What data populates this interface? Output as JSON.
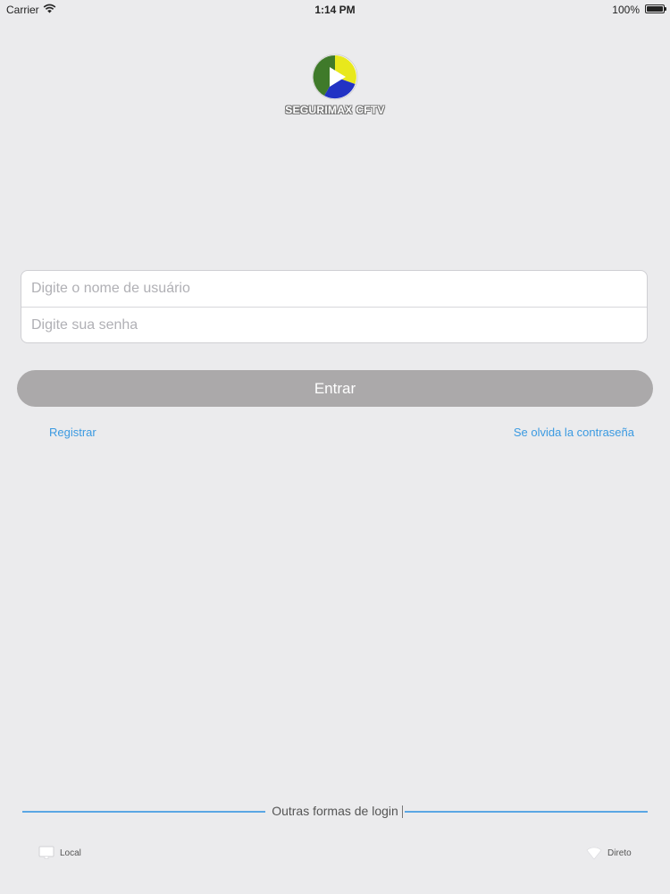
{
  "status_bar": {
    "carrier": "Carrier",
    "time": "1:14 PM",
    "battery": "100%"
  },
  "logo": {
    "icon": "play-logo-icon",
    "text": "SEGURIMAX CFTV",
    "colors": {
      "green": "#3f7a2a",
      "yellow": "#e8e81c",
      "blue": "#2233c4"
    }
  },
  "login_form": {
    "username_placeholder": "Digite o nome de usuário",
    "password_placeholder": "Digite sua senha",
    "submit_label": "Entrar"
  },
  "links": {
    "register": "Registrar",
    "forgot_password": "Se olvida la contraseña"
  },
  "other_login": {
    "title": "Outras formas de login",
    "options": [
      {
        "icon": "monitor-icon",
        "label": "Local"
      },
      {
        "icon": "wifi-icon",
        "label": "Direto"
      }
    ]
  },
  "colors": {
    "background": "#ebebed",
    "button": "#aba9aa",
    "link": "#3b9ae1",
    "divider": "#5aa6e4"
  }
}
